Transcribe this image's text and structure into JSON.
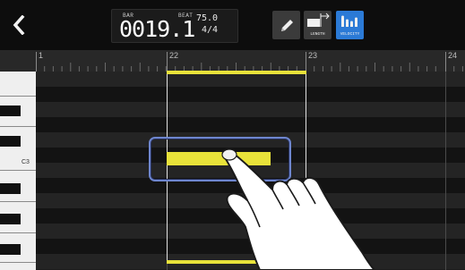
{
  "header": {
    "position_label": "BAR",
    "beat_label": "BEAT",
    "position_value": "0019.1",
    "tempo": "75.0",
    "time_signature": "4/4",
    "tools": [
      {
        "name": "pencil",
        "caption": ""
      },
      {
        "name": "length",
        "caption": "LENGTH"
      },
      {
        "name": "velocity",
        "caption": "VELOCITY",
        "active": true
      }
    ]
  },
  "ruler": {
    "bar_numbers": [
      "1",
      "22",
      "23",
      "24"
    ]
  },
  "keyboard": {
    "visible_note_label": "C3"
  },
  "colors": {
    "note": "#e8e23a",
    "selection_frame": "#6e86cf",
    "active_tool": "#2b7ad6"
  }
}
